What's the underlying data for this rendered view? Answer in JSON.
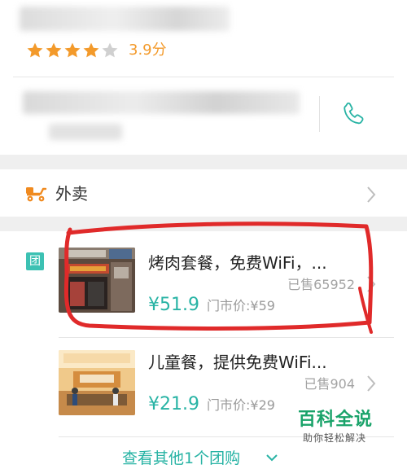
{
  "rating": {
    "stars_filled": 4,
    "stars_total": 5,
    "score_text": "3.9分"
  },
  "takeout": {
    "label": "外卖"
  },
  "deals": {
    "badge": "团",
    "items": [
      {
        "title": "烤肉套餐，免费WiFi，...",
        "sold": "已售65952",
        "price": "¥51.9",
        "market_price": "门市价:¥59"
      },
      {
        "title": "儿童餐，提供免费WiFi...",
        "sold": "已售904",
        "price": "¥21.9",
        "market_price": "门市价:¥29"
      }
    ],
    "more_link": "查看其他1个团购"
  },
  "watermark": {
    "brand": "百科全说",
    "slogan": "助你轻松解决"
  },
  "colors": {
    "accent": "#27b3a4",
    "star": "#f39a2b",
    "annotation": "#e02a2a"
  }
}
